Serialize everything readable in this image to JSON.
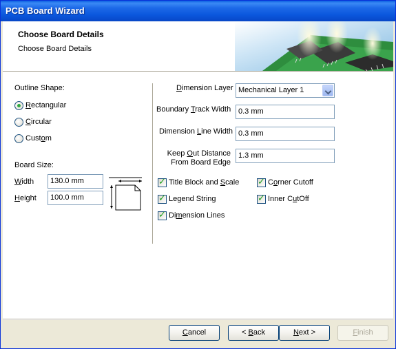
{
  "window": {
    "title": "PCB Board Wizard"
  },
  "header": {
    "title": "Choose Board Details",
    "subtitle": "Choose Board Details"
  },
  "left": {
    "outline_label": "Outline Shape:",
    "shapes": [
      {
        "label": "Rectangular",
        "checked": true
      },
      {
        "label": "Circular",
        "checked": false
      },
      {
        "label": "Custom",
        "checked": false
      }
    ],
    "board_size_label": "Board Size:",
    "width_label": "Width",
    "width_value": "130.0 mm",
    "height_label": "Height",
    "height_value": "100.0 mm"
  },
  "right": {
    "dimension_layer_label": "Dimension Layer",
    "dimension_layer_value": "Mechanical Layer 1",
    "boundary_track_label": "Boundary Track Width",
    "boundary_track_value": "0.3 mm",
    "dimension_line_label": "Dimension Line Width",
    "dimension_line_value": "0.3 mm",
    "keepout_label_1": "Keep Out Distance",
    "keepout_label_2": "From Board Edge",
    "keepout_value": "1.3 mm",
    "checkboxes": {
      "title_block": {
        "label": "Title Block and Scale",
        "checked": true
      },
      "corner_cutoff": {
        "label": "Corner Cutoff",
        "checked": true
      },
      "legend_string": {
        "label": "Legend String",
        "checked": true
      },
      "inner_cutoff": {
        "label": "Inner CutOff",
        "checked": true
      },
      "dimension_lines": {
        "label": "Dimension Lines",
        "checked": true
      }
    }
  },
  "buttons": {
    "cancel": "Cancel",
    "back": "< Back",
    "next": "Next >",
    "finish": "Finish"
  },
  "colors": {
    "titlebar": "#0a56dc",
    "dialog_bg": "#ece9d8",
    "check_green": "#21a121"
  }
}
